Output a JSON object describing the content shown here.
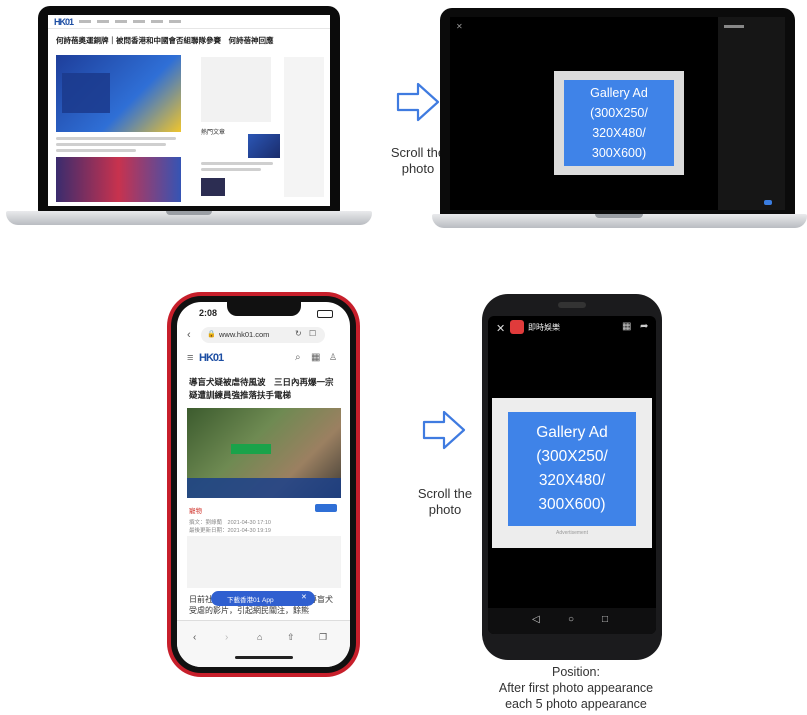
{
  "desktop": {
    "site_logo": "HK01",
    "article_title_cn": "何詩蓓奧運銅牌｜被問香港和中國會否組聯隊參賽　何詩蓓神回應",
    "hot_label_cn": "熱門文章",
    "ad_text": [
      "Gallery Ad",
      "(300X250/",
      "320X480/",
      "300X600)"
    ]
  },
  "mobile": {
    "time": "2:08",
    "url": "www.hk01.com",
    "site_logo": "HK01",
    "headline_cn": "導盲犬疑被虐待風波　三日內再爆一宗　疑遭訓練員強推落扶手電梯",
    "section_cn": "寵物",
    "author_cn": "撰文：劉綠蘭",
    "date_cn": "2021-04-30 17:10",
    "updated_cn": "最後更新日期：2021-04-30 19:19",
    "body_cn": "日前社　　　　　　　　　　疑似導盲犬受虐的影片，引起網民關注，餘熊",
    "download_bar_cn": "下載香港01 App",
    "app_title_cn": "即時娛樂",
    "ad_text": [
      "Gallery Ad",
      "(300X250/",
      "320X480/",
      "300X600)"
    ],
    "advertisement_label": "Advertisement"
  },
  "labels": {
    "scroll_top": [
      "Scroll the",
      "photo"
    ],
    "scroll_bottom": [
      "Scroll the",
      "photo"
    ],
    "position_note": [
      "Position:",
      "After first photo appearance",
      "each 5 photo appearance"
    ]
  },
  "colors": {
    "ad_blue": "#3f83e8",
    "iphone_red": "#c71f2b",
    "brand_blue": "#1d4ea3"
  },
  "icons": [
    "arrow-right-outline-icon",
    "close-icon",
    "grid-icon",
    "share-icon",
    "back-icon",
    "forward-icon",
    "home-icon",
    "lock-icon",
    "refresh-icon",
    "bookmark-icon",
    "search-icon",
    "menu-icon"
  ]
}
